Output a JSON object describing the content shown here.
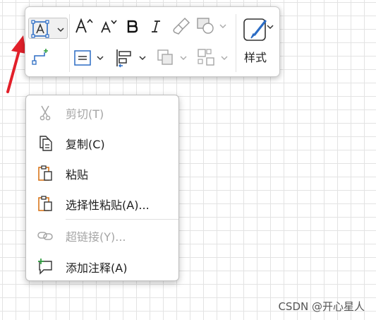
{
  "toolbar": {
    "text_box_icon": "text-box-icon",
    "style_label": "样式"
  },
  "context_menu": {
    "items": [
      {
        "label": "剪切(T)",
        "icon": "scissors-icon",
        "enabled": false
      },
      {
        "label": "复制(C)",
        "icon": "copy-icon",
        "enabled": true
      },
      {
        "label": "粘贴",
        "icon": "paste-icon",
        "enabled": true
      },
      {
        "label": "选择性粘贴(A)...",
        "icon": "paste-special-icon",
        "enabled": true
      },
      {
        "label": "超链接(Y)...",
        "icon": "link-icon",
        "enabled": false
      },
      {
        "label": "添加注释(A)",
        "icon": "add-comment-icon",
        "enabled": true
      }
    ]
  },
  "watermark": "CSDN @开心星人",
  "colors": {
    "accent_blue": "#2b6cc4",
    "annotation_red": "#e2202a",
    "paste_orange": "#d8761c",
    "comment_green": "#2e9e3e"
  }
}
